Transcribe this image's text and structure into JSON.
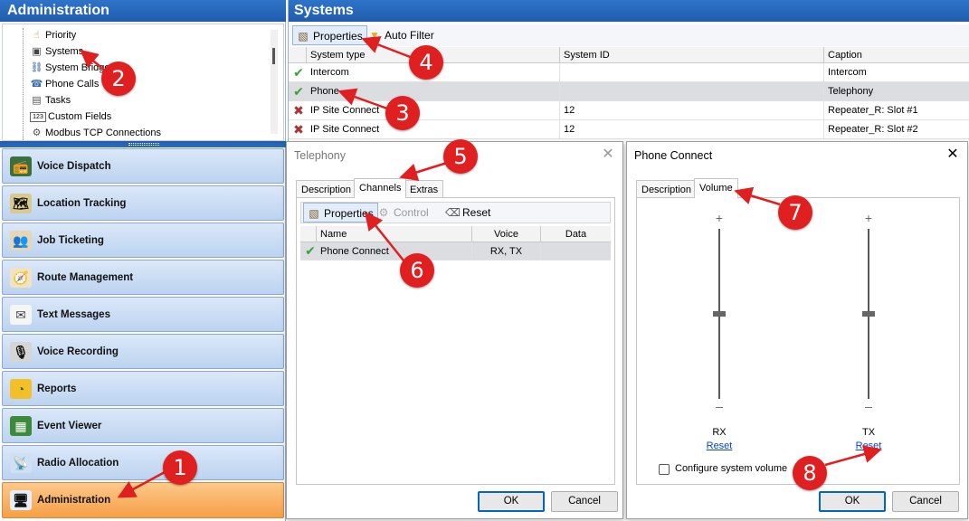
{
  "left_pane": {
    "title": "Administration",
    "tree_items": [
      {
        "label": "Priority",
        "icon": "hand-icon",
        "glyph": "☝"
      },
      {
        "label": "Systems",
        "icon": "systems-icon",
        "glyph": "▣"
      },
      {
        "label": "System Bridge",
        "icon": "bridge-icon",
        "glyph": "⛓"
      },
      {
        "label": "Phone Calls",
        "icon": "phone-icon",
        "glyph": "☎"
      },
      {
        "label": "Tasks",
        "icon": "tasks-icon",
        "glyph": "▤"
      },
      {
        "label": "Custom Fields",
        "icon": "custom-fields-icon",
        "glyph": "123"
      },
      {
        "label": "Modbus TCP Connections",
        "icon": "modbus-icon",
        "glyph": "⚙"
      }
    ],
    "nav_buttons": [
      {
        "label": "Voice Dispatch",
        "icon": "radio-icon",
        "glyph": "📻"
      },
      {
        "label": "Location Tracking",
        "icon": "location-icon",
        "glyph": "🗺"
      },
      {
        "label": "Job Ticketing",
        "icon": "ticket-icon",
        "glyph": "👥"
      },
      {
        "label": "Route Management",
        "icon": "route-icon",
        "glyph": "🧭"
      },
      {
        "label": "Text Messages",
        "icon": "envelope-icon",
        "glyph": "✉"
      },
      {
        "label": "Voice Recording",
        "icon": "microphone-icon",
        "glyph": "🎙"
      },
      {
        "label": "Reports",
        "icon": "chart-icon",
        "glyph": "◔"
      },
      {
        "label": "Event Viewer",
        "icon": "event-icon",
        "glyph": "▦"
      },
      {
        "label": "Radio Allocation",
        "icon": "radio-allocation-icon",
        "glyph": "📡"
      },
      {
        "label": "Administration",
        "icon": "admin-icon",
        "glyph": "🖥"
      }
    ]
  },
  "systems": {
    "title": "Systems",
    "toolbar": {
      "properties": "Properties",
      "auto_filter": "Auto Filter"
    },
    "columns": [
      "System type",
      "System ID",
      "Caption"
    ],
    "rows": [
      {
        "status": "ok",
        "glyph": "✔",
        "type": "Intercom",
        "id": "",
        "caption": "Intercom"
      },
      {
        "status": "ok",
        "glyph": "✔",
        "type": "Phone",
        "id": "",
        "caption": "Telephony"
      },
      {
        "status": "error",
        "glyph": "✖",
        "type": "IP Site Connect",
        "id": "12",
        "caption": "Repeater_R: Slot #1"
      },
      {
        "status": "error",
        "glyph": "✖",
        "type": "IP Site Connect",
        "id": "12",
        "caption": "Repeater_R: Slot #2"
      }
    ]
  },
  "telephony_dialog": {
    "title": "Telephony",
    "tabs": [
      "Description",
      "Channels",
      "Extras"
    ],
    "toolbar": {
      "properties": "Properties",
      "control": "Control",
      "reset": "Reset"
    },
    "columns": [
      "Name",
      "Voice",
      "Data"
    ],
    "rows": [
      {
        "glyph": "✔",
        "name": "Phone Connect",
        "voice": "RX, TX",
        "data": ""
      }
    ],
    "ok": "OK",
    "cancel": "Cancel"
  },
  "phone_connect_dialog": {
    "title": "Phone Connect",
    "tabs": [
      "Description",
      "Volume"
    ],
    "sliders": [
      {
        "label": "RX",
        "reset": "Reset",
        "plus": "+",
        "minus": "–",
        "level": 0.5
      },
      {
        "label": "TX",
        "reset": "Reset",
        "plus": "+",
        "minus": "–",
        "level": 0.5
      }
    ],
    "configure_label": "Configure system volume",
    "configure_checked": false,
    "ok": "OK",
    "cancel": "Cancel"
  },
  "markers": [
    "1",
    "2",
    "3",
    "4",
    "5",
    "6",
    "7",
    "8"
  ],
  "colors": {
    "marker": "#e02020",
    "title_blue": "#1f5cad",
    "active_nav": "#f79f46"
  }
}
